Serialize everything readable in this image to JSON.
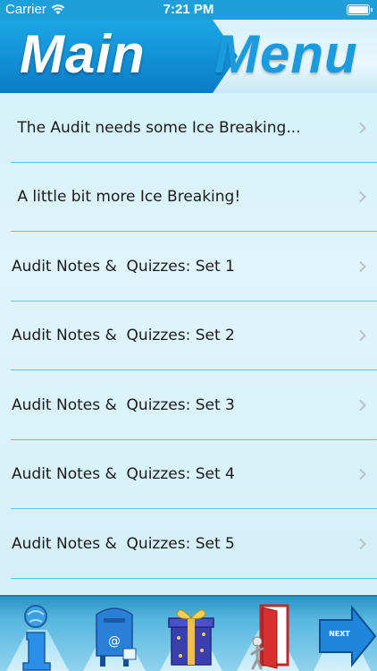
{
  "status_bar": {
    "carrier": "Carrier",
    "time": "7:21 PM"
  },
  "header": {
    "title_left": "Main",
    "title_right": "Menu"
  },
  "menu": {
    "items": [
      {
        "label": " The Audit needs some Ice Breaking..."
      },
      {
        "label": " A little bit more Ice Breaking!"
      },
      {
        "label": "Audit Notes &  Quizzes: Set 1"
      },
      {
        "label": "Audit Notes &  Quizzes: Set 2"
      },
      {
        "label": "Audit Notes &  Quizzes: Set 3"
      },
      {
        "label": "Audit Notes &  Quizzes: Set 4"
      },
      {
        "label": "Audit Notes &  Quizzes: Set 5"
      }
    ]
  },
  "toolbar": {
    "items": [
      {
        "icon": "info-icon"
      },
      {
        "icon": "mailbox-icon"
      },
      {
        "icon": "gift-icon"
      },
      {
        "icon": "exit-door-icon"
      },
      {
        "icon": "next-arrow-icon",
        "label": "NEXT"
      }
    ]
  },
  "colors": {
    "accent": "#1aa7e6",
    "divider": "#5dc6ea",
    "toolbar": "#2a93c4"
  }
}
